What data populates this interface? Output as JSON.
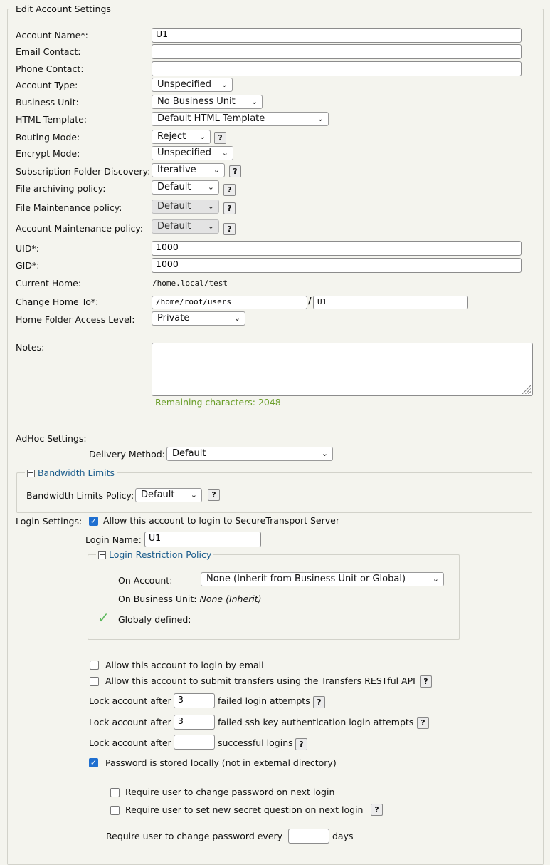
{
  "section_title": "Edit Account Settings",
  "fields": {
    "account_name": {
      "label": "Account Name*:",
      "value": "U1"
    },
    "email": {
      "label": "Email Contact:",
      "value": ""
    },
    "phone": {
      "label": "Phone Contact:",
      "value": ""
    },
    "account_type": {
      "label": "Account Type:",
      "value": "Unspecified"
    },
    "business_unit": {
      "label": "Business Unit:",
      "value": "No Business Unit"
    },
    "html_template": {
      "label": "HTML Template:",
      "value": "Default HTML Template"
    },
    "routing_mode": {
      "label": "Routing Mode:",
      "value": "Reject"
    },
    "encrypt_mode": {
      "label": "Encrypt Mode:",
      "value": "Unspecified"
    },
    "subscription_discovery": {
      "label": "Subscription Folder Discovery:",
      "value": "Iterative"
    },
    "file_archiving": {
      "label": "File archiving policy:",
      "value": "Default"
    },
    "file_maintenance": {
      "label": "File Maintenance policy:",
      "value": "Default"
    },
    "account_maintenance": {
      "label": "Account Maintenance policy:",
      "value": "Default"
    },
    "uid": {
      "label": "UID*:",
      "value": "1000"
    },
    "gid": {
      "label": "GID*:",
      "value": "1000"
    },
    "current_home": {
      "label": "Current Home:",
      "value": "/home.local/test"
    },
    "change_home": {
      "label": "Change Home To*:",
      "base": "/home/root/users",
      "separator": "/",
      "folder": "U1"
    },
    "home_access": {
      "label": "Home Folder Access Level:",
      "value": "Private"
    },
    "notes": {
      "label": "Notes:",
      "value": "",
      "remaining": "Remaining characters: 2048"
    }
  },
  "adhoc": {
    "label": "AdHoc Settings:",
    "delivery_label": "Delivery Method:",
    "delivery_value": "Default"
  },
  "bandwidth": {
    "legend": "Bandwidth Limits",
    "policy_label": "Bandwidth Limits Policy:",
    "policy_value": "Default"
  },
  "login": {
    "label": "Login Settings:",
    "allow_server_login": "Allow this account to login to SecureTransport Server",
    "allow_server_login_checked": true,
    "login_name_label": "Login Name:",
    "login_name_value": "U1",
    "restriction": {
      "legend": "Login Restriction Policy",
      "on_account_label": "On Account:",
      "on_account_value": "None (Inherit from Business Unit or Global)",
      "on_bu_label": "On Business Unit:",
      "on_bu_value": "None (Inherit)",
      "global_label": "Globaly defined:"
    },
    "allow_email": "Allow this account to login by email",
    "allow_email_checked": false,
    "allow_rest": "Allow this account to submit transfers using the Transfers RESTful API",
    "allow_rest_checked": false,
    "lock_prefix": "Lock account after",
    "lock_failed_value": "3",
    "lock_failed_suffix": "failed login attempts",
    "lock_ssh_value": "3",
    "lock_ssh_suffix": "failed ssh key authentication login attempts",
    "lock_success_value": "",
    "lock_success_suffix": "successful logins",
    "password_local": "Password is stored locally (not in external directory)",
    "password_local_checked": true,
    "require_change": "Require user to change password on next login",
    "require_change_checked": false,
    "require_secret": "Require user to set new secret question on next login",
    "require_secret_checked": false,
    "change_every_prefix": "Require user to change password every",
    "change_every_value": "",
    "change_every_suffix": "days"
  },
  "icons": {
    "help": "?",
    "chevron": "⌄",
    "collapse": "−",
    "check": "✓"
  }
}
